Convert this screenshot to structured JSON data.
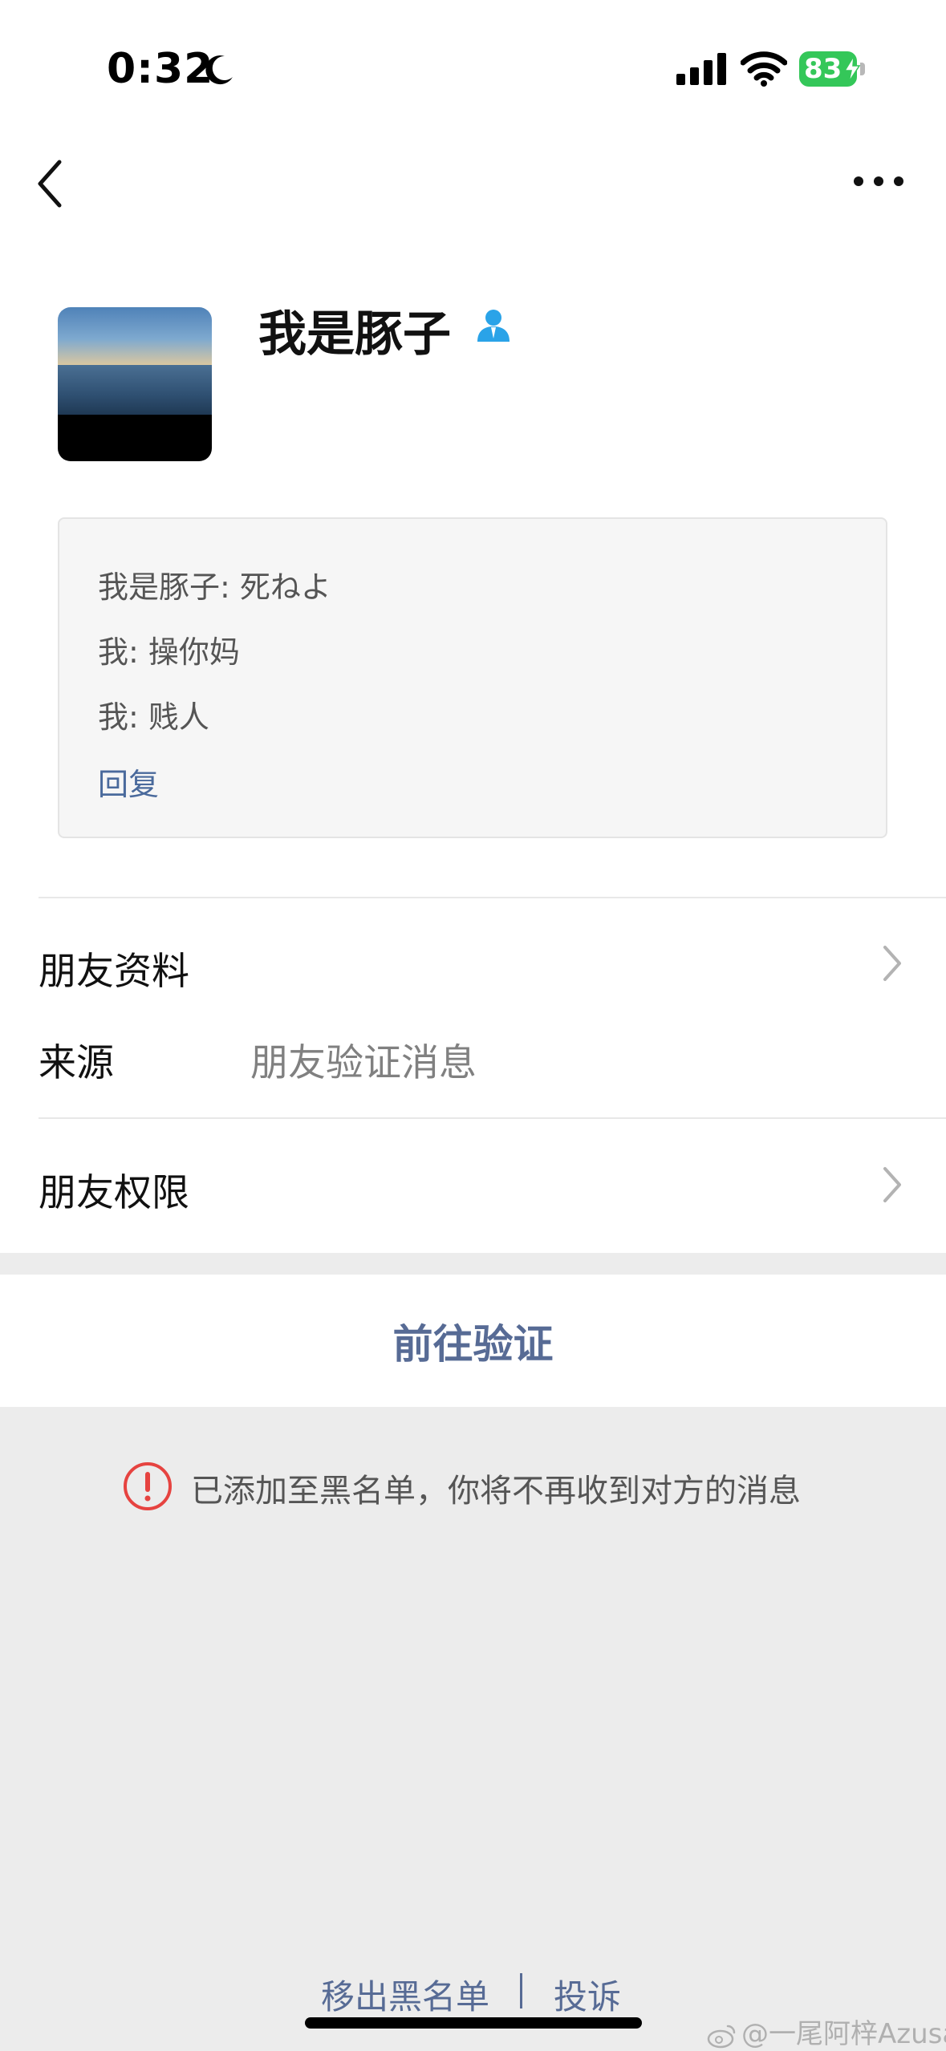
{
  "status_bar": {
    "time": "0:32",
    "battery": "83",
    "icons": [
      "moon-icon",
      "signal-icon",
      "wifi-icon",
      "battery-icon"
    ]
  },
  "nav": {
    "back_icon": "chevron-left-icon",
    "more_icon": "more-dots-icon"
  },
  "profile": {
    "name": "我是豚子",
    "badge_icon": "person-icon",
    "avatar": "sea-horizon-photo"
  },
  "messages": {
    "lines": [
      "我是豚子: 死ねよ",
      "我: 操你妈",
      "我: 贱人"
    ],
    "reply_label": "回复"
  },
  "rows": {
    "friend_info": "朋友资料",
    "source_label": "来源",
    "source_value": "朋友验证消息",
    "friend_permission": "朋友权限"
  },
  "actions": {
    "verify": "前往验证"
  },
  "notice": {
    "text": "已添加至黑名单，你将不再收到对方的消息",
    "icon": "exclamation-circle-icon"
  },
  "footer": {
    "remove_blacklist": "移出黑名单",
    "separator": "|",
    "report": "投诉"
  },
  "watermark": "@一尾阿梓Azusa",
  "colors": {
    "link": "#576b95",
    "reply_link": "#4a6a9c",
    "battery_green": "#34c759",
    "warning_red": "#e64340",
    "badge_blue": "#2aa3e8",
    "background_gray": "#ececec"
  }
}
